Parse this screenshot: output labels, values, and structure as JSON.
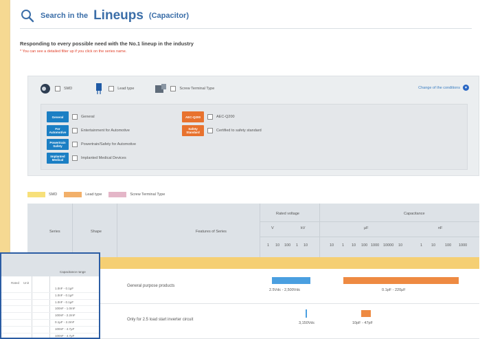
{
  "header": {
    "title_prefix": "Search in the",
    "title_main": "Lineups",
    "title_suffix": "(Capacitor)"
  },
  "subtitle": "Responding to every possible need with the No.1 lineup in the industry",
  "note": "* You can see a detailed filter up if you click on the series name.",
  "types": [
    {
      "label": "SMD",
      "icon": "smd-chip-icon"
    },
    {
      "label": "Lead type",
      "icon": "lead-type-icon"
    },
    {
      "label": "Screw Terminal Type",
      "icon": "screw-terminal-icon"
    }
  ],
  "change_conditions": "Change of the conditions",
  "categories_left": [
    {
      "tag": "General",
      "label": "General"
    },
    {
      "tag": "For Automotive",
      "label": "Entertainment for Automotive"
    },
    {
      "tag": "Powertrain Safety",
      "label": "Powertrain/Safety for Automotive"
    },
    {
      "tag": "Implanted Medical",
      "label": "Implanted Medical Devices"
    }
  ],
  "categories_right": [
    {
      "tag": "AEC-Q200",
      "label": "AEC-Q200"
    },
    {
      "tag": "Safety Standard",
      "label": "Certified to safety standard"
    }
  ],
  "legend": [
    {
      "label": "SMD",
      "color": "#f7e07a"
    },
    {
      "label": "Lead type",
      "color": "#f2b06a"
    },
    {
      "label": "Screw Terminal Type",
      "color": "#e4b6c8"
    }
  ],
  "table": {
    "headers": {
      "series": "Series",
      "shape": "Shape",
      "features": "Features of Series",
      "rated_voltage": "Rated voltage",
      "capacitance": "Capacitance",
      "v": "V",
      "kv": "kV",
      "uf": "μF",
      "nf": "nF"
    },
    "voltage_ticks": [
      "1",
      "10",
      "100",
      "1",
      "10"
    ],
    "cap_ticks": [
      "10",
      "1",
      "10",
      "100",
      "1000",
      "10000",
      "10",
      "1",
      "10",
      "100",
      "1000"
    ],
    "rows": [
      {
        "feature": "General purpose products",
        "voltage_label": "2.5Vdc - 2,500Vdc",
        "cap_label": "0.1pF - 220μF",
        "voltage_color": "#4a9fe0",
        "cap_color": "#ee8a42"
      },
      {
        "feature": "Only for 2.5 load start inverter circuit",
        "voltage_label": "3,150Vdc",
        "cap_label": "10pF - 47pF",
        "voltage_color": "#4a9fe0",
        "cap_color": "#ee8a42"
      }
    ]
  },
  "inset": {
    "title": "Capacitance range",
    "col_a": "Rated",
    "col_b": "Unit",
    "values": [
      "1.0nF - 0.1μF",
      "1.0nF - 0.1μF",
      "1.0nF - 0.1μF",
      "100nF - 1.0mF",
      "100nF - 2.2mF",
      "0.1μF - 2.2mF",
      "100nF - 4.7μF",
      "100nF - 4.7μF"
    ]
  }
}
